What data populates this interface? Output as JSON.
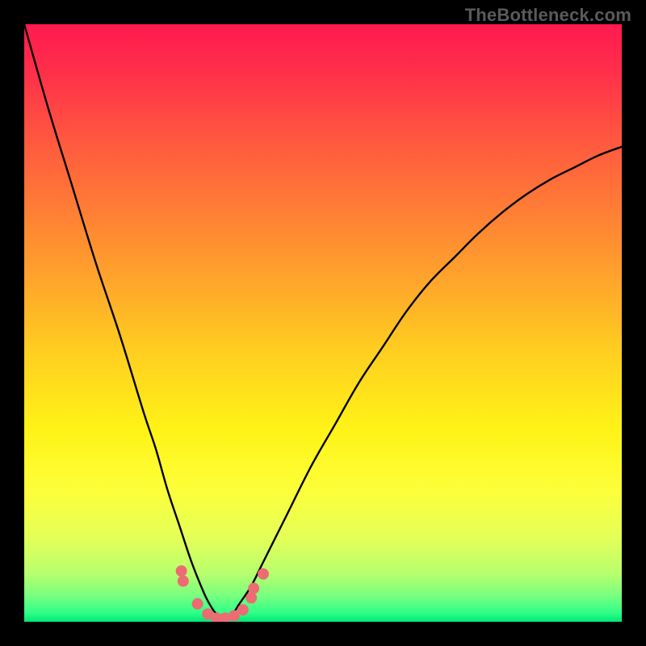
{
  "watermark": "TheBottleneck.com",
  "chart_data": {
    "type": "line",
    "title": "",
    "xlabel": "",
    "ylabel": "",
    "xlim": [
      0,
      100
    ],
    "ylim": [
      0,
      100
    ],
    "x": [
      0,
      4,
      8,
      12,
      16,
      20,
      22,
      24,
      26,
      28,
      30,
      31,
      32,
      33,
      34,
      35,
      36,
      38,
      40,
      44,
      48,
      52,
      56,
      60,
      64,
      68,
      72,
      76,
      80,
      84,
      88,
      92,
      96,
      100
    ],
    "values": [
      100,
      86,
      73,
      60,
      48,
      35,
      29,
      22,
      16,
      10,
      5,
      3,
      1.5,
      1,
      1,
      1.5,
      3,
      6,
      10,
      18,
      26,
      33,
      40,
      46,
      52,
      57,
      61,
      65,
      68.5,
      71.5,
      74,
      76,
      78,
      79.5
    ],
    "gradient_stops": [
      {
        "offset": 0.0,
        "color": "#ff1a4f"
      },
      {
        "offset": 0.08,
        "color": "#ff2f4a"
      },
      {
        "offset": 0.18,
        "color": "#ff5340"
      },
      {
        "offset": 0.3,
        "color": "#ff7a36"
      },
      {
        "offset": 0.42,
        "color": "#ffa22c"
      },
      {
        "offset": 0.55,
        "color": "#ffcf20"
      },
      {
        "offset": 0.68,
        "color": "#fff317"
      },
      {
        "offset": 0.78,
        "color": "#fdff3a"
      },
      {
        "offset": 0.86,
        "color": "#e4ff58"
      },
      {
        "offset": 0.92,
        "color": "#b6ff6e"
      },
      {
        "offset": 0.955,
        "color": "#7bff7f"
      },
      {
        "offset": 0.985,
        "color": "#2fff86"
      },
      {
        "offset": 1.0,
        "color": "#00e676"
      }
    ],
    "markers": {
      "color": "#ed6b72",
      "radius_px": 7,
      "points": [
        {
          "x": 26.3,
          "y": 8.5
        },
        {
          "x": 26.6,
          "y": 6.8
        },
        {
          "x": 29.0,
          "y": 3.0
        },
        {
          "x": 30.7,
          "y": 1.3
        },
        {
          "x": 32.2,
          "y": 0.6
        },
        {
          "x": 33.6,
          "y": 0.6
        },
        {
          "x": 35.1,
          "y": 1.0
        },
        {
          "x": 36.6,
          "y": 2.0
        },
        {
          "x": 38.0,
          "y": 4.0
        },
        {
          "x": 38.4,
          "y": 5.6
        },
        {
          "x": 40.0,
          "y": 8.0
        }
      ]
    }
  }
}
